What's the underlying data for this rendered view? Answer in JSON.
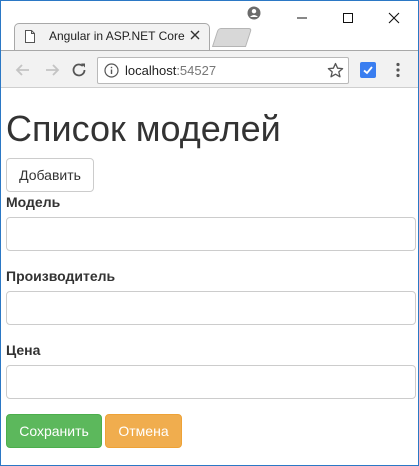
{
  "browser": {
    "tab_title": "Angular in ASP.NET Core",
    "url_host": "localhost",
    "url_port": ":54527"
  },
  "page": {
    "title": "Список моделей",
    "add_button": "Добавить",
    "fields": {
      "model_label": "Модель",
      "model_value": "",
      "maker_label": "Производитель",
      "maker_value": "",
      "price_label": "Цена",
      "price_value": ""
    },
    "save_button": "Сохранить",
    "cancel_button": "Отмена"
  },
  "colors": {
    "window_border": "#2b78c5",
    "save": "#5cb85c",
    "cancel": "#f0ad4e",
    "extension": "#3a7ef0"
  },
  "icons": [
    "page-icon",
    "close-icon",
    "profile-icon",
    "minimize-icon",
    "maximize-icon",
    "window-close-icon",
    "back-arrow-icon",
    "forward-arrow-icon",
    "reload-icon",
    "info-icon",
    "star-icon",
    "extension-icon",
    "kebab-menu-icon"
  ]
}
